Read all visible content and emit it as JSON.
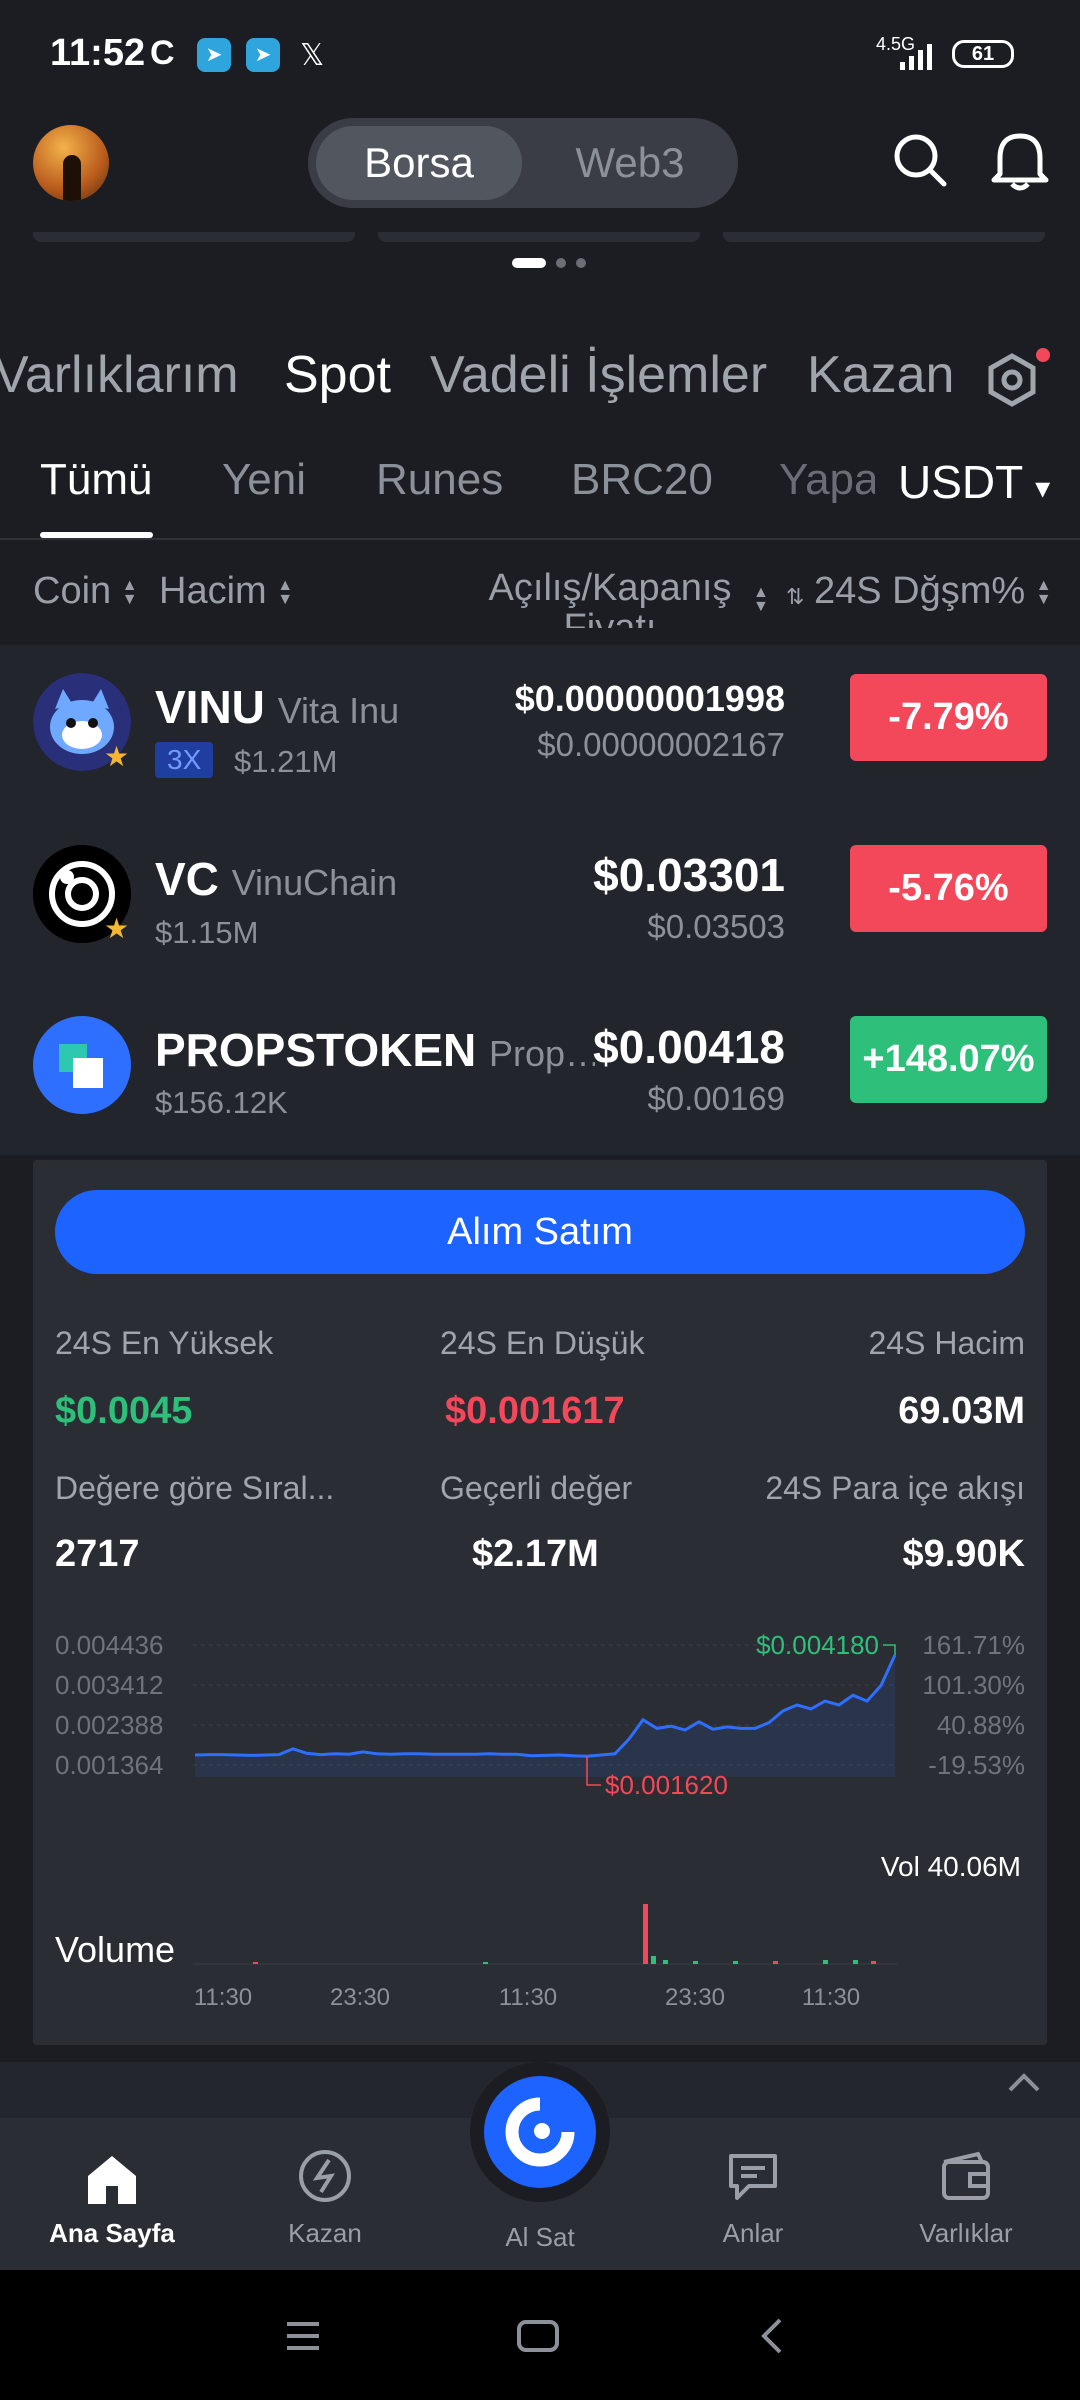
{
  "status_bar": {
    "time": "11:52",
    "network": "4.5G",
    "battery": "61",
    "x_icon_label": "𝕏"
  },
  "header": {
    "tabs": [
      "Borsa",
      "Web3"
    ],
    "active_tab": "Borsa"
  },
  "market_tabs": {
    "items": [
      "Varlıklarım",
      "Spot",
      "Vadeli İşlemler",
      "Kazan"
    ],
    "active": "Spot"
  },
  "filter_tabs": {
    "items": [
      "Tümü",
      "Yeni",
      "Runes",
      "BRC20",
      "Yapa"
    ],
    "active": "Tümü",
    "quote": "USDT",
    "quote_arrow": "▾"
  },
  "columns": {
    "coin": "Coin",
    "volume": "Hacim",
    "price": "Açılış/Kapanış Fiyatı",
    "change": "24S Dğşm%"
  },
  "rows": [
    {
      "symbol": "VINU",
      "name": "Vita Inu",
      "leverage": "3X",
      "volume": "$1.21M",
      "price": "$0.00000001998",
      "prev": "$0.00000002167",
      "change": "-7.79%"
    },
    {
      "symbol": "VC",
      "name": "VinuChain",
      "volume": "$1.15M",
      "price": "$0.03301",
      "prev": "$0.03503",
      "change": "-5.76%"
    },
    {
      "symbol": "PROPSTOKEN",
      "name": "Prop…",
      "volume": "$156.12K",
      "price": "$0.00418",
      "prev": "$0.00169",
      "change": "+148.07%"
    }
  ],
  "detail": {
    "trade_button": "Alım Satım",
    "stats": [
      {
        "label": "24S En Yüksek",
        "value": "$0.0045"
      },
      {
        "label": "24S En Düşük",
        "value": "$0.001617"
      },
      {
        "label": "24S Hacim",
        "value": "69.03M"
      },
      {
        "label": "Değere göre Sıral...",
        "value": "2717"
      },
      {
        "label": "Geçerli değer",
        "value": "$2.17M"
      },
      {
        "label": "24S Para içe akışı",
        "value": "$9.90K"
      }
    ],
    "colors": {
      "green": "#2ec07a",
      "red": "#f2485a",
      "blue": "#2f6fff"
    }
  },
  "chart_data": {
    "type": "line",
    "y_axis_left": [
      "0.004436",
      "0.003412",
      "0.002388",
      "0.001364"
    ],
    "y_axis_right": [
      "161.71%",
      "101.30%",
      "40.88%",
      "-19.53%"
    ],
    "ylim": [
      0.001364,
      0.004436
    ],
    "high_label": "$0.004180",
    "low_label": "$0.001620",
    "x_ticks": [
      "11:30",
      "23:30",
      "11:30",
      "23:30",
      "11:30"
    ],
    "volume_label": "Vol 40.06M",
    "volume_title": "Volume",
    "series": [
      {
        "values": [
          0.00162,
          0.00163,
          0.00163,
          0.00162,
          0.00161,
          0.00162,
          0.00163,
          0.00178,
          0.00166,
          0.00163,
          0.00165,
          0.00164,
          0.0017,
          0.00165,
          0.00164,
          0.00165,
          0.00165,
          0.00164,
          0.00164,
          0.00164,
          0.00164,
          0.00165,
          0.00164,
          0.00164,
          0.0016,
          0.00161,
          0.00162,
          0.0016,
          0.00159,
          0.00162,
          0.00165,
          0.00203,
          0.00252,
          0.0023,
          0.00236,
          0.00226,
          0.00247,
          0.00228,
          0.00234,
          0.0023,
          0.0023,
          0.00245,
          0.00275,
          0.0029,
          0.0028,
          0.003,
          0.0029,
          0.00315,
          0.003,
          0.0034,
          0.00418
        ]
      }
    ]
  },
  "bottom_nav": {
    "items": [
      "Ana Sayfa",
      "Kazan",
      "Al Sat",
      "Anlar",
      "Varlıklar"
    ],
    "active": "Ana Sayfa"
  }
}
